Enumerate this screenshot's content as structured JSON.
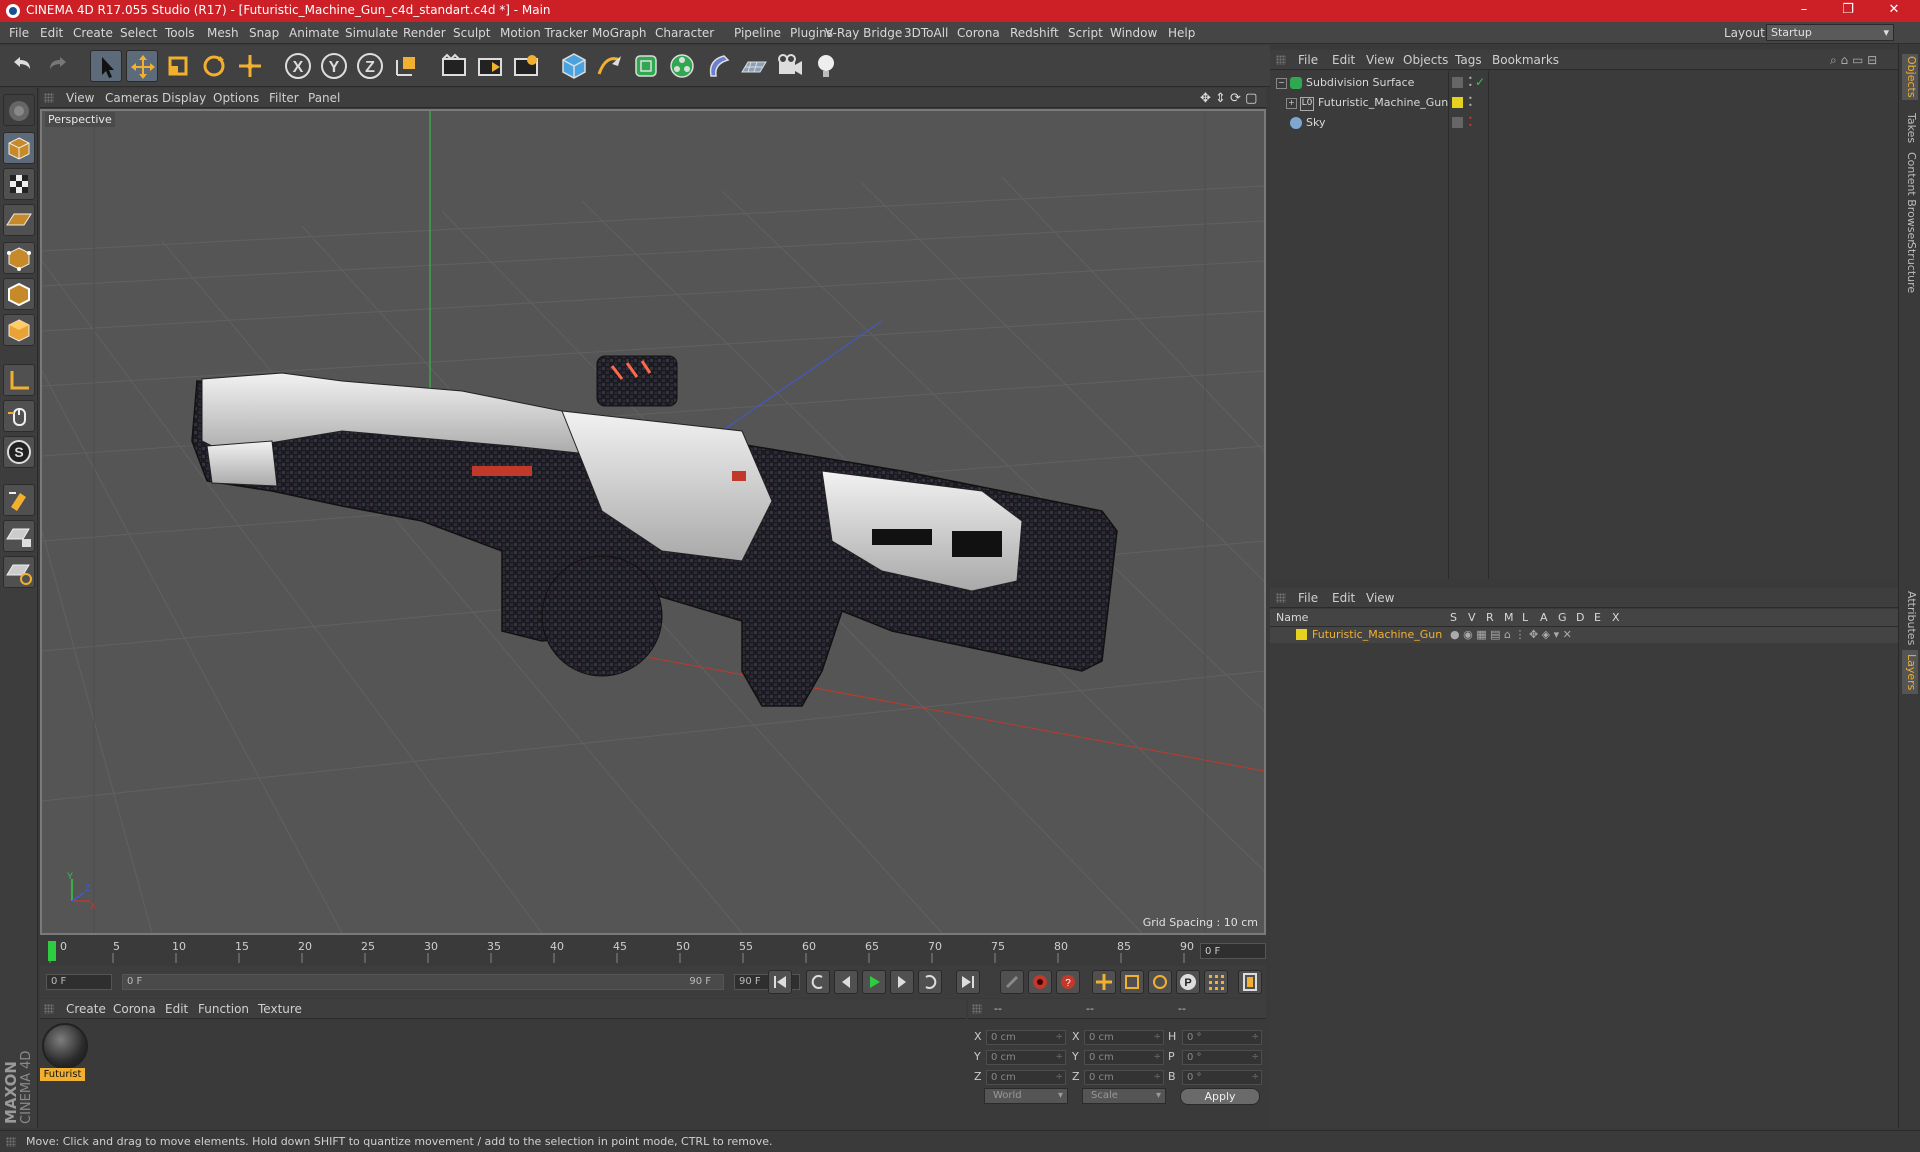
{
  "window": {
    "title": "CINEMA 4D R17.055 Studio (R17) - [Futuristic_Machine_Gun_c4d_standart.c4d *] - Main",
    "minimize": "–",
    "maximize": "❐",
    "close": "✕"
  },
  "menubar": {
    "items": [
      "File",
      "Edit",
      "Create",
      "Select",
      "Tools",
      "Mesh",
      "Snap",
      "Animate",
      "Simulate",
      "Render",
      "Sculpt",
      "Motion Tracker",
      "MoGraph",
      "Character",
      "Pipeline",
      "Plugins",
      "V-Ray Bridge",
      "3DToAll",
      "Corona",
      "Redshift",
      "Script",
      "Window",
      "Help"
    ],
    "layout_label": "Layout:",
    "layout_value": "Startup"
  },
  "viewport": {
    "menu": [
      "View",
      "Cameras",
      "Display",
      "Options",
      "Filter",
      "Panel"
    ],
    "camera_label": "Perspective",
    "grid_spacing": "Grid Spacing : 10 cm"
  },
  "timeline": {
    "ticks": [
      "0",
      "5",
      "10",
      "15",
      "20",
      "25",
      "30",
      "35",
      "40",
      "45",
      "50",
      "55",
      "60",
      "65",
      "70",
      "75",
      "80",
      "85",
      "90"
    ],
    "current_frame": "0 F",
    "start_field": "0 F",
    "range_start": "0 F",
    "range_end": "90 F",
    "end_field": "90 F"
  },
  "material_manager": {
    "menu": [
      "Create",
      "Corona",
      "Edit",
      "Function",
      "Texture"
    ],
    "material_name": "Futurist"
  },
  "coordinates": {
    "headers": [
      "--",
      "--",
      "--"
    ],
    "rows": [
      {
        "l1": "X",
        "v1": "0 cm",
        "l2": "X",
        "v2": "0 cm",
        "l3": "H",
        "v3": "0 °"
      },
      {
        "l1": "Y",
        "v1": "0 cm",
        "l2": "Y",
        "v2": "0 cm",
        "l3": "P",
        "v3": "0 °"
      },
      {
        "l1": "Z",
        "v1": "0 cm",
        "l2": "Z",
        "v2": "0 cm",
        "l3": "B",
        "v3": "0 °"
      }
    ],
    "mode_dropdown": "World",
    "scale_dropdown": "Scale",
    "apply_label": "Apply"
  },
  "object_manager": {
    "menu": [
      "File",
      "Edit",
      "View",
      "Objects",
      "Tags",
      "Bookmarks"
    ],
    "objects": [
      "Subdivision Surface",
      "Futuristic_Machine_Gun",
      "Sky"
    ]
  },
  "layer_manager": {
    "menu": [
      "File",
      "Edit",
      "View"
    ],
    "columns": [
      "Name",
      "S",
      "V",
      "R",
      "M",
      "L",
      "A",
      "G",
      "D",
      "E",
      "X"
    ],
    "layer_name": "Futuristic_Machine_Gun"
  },
  "right_tabs": [
    "Objects",
    "Takes",
    "Content Browser",
    "Structure",
    "Attributes",
    "Layers"
  ],
  "status": {
    "text": "Move: Click and drag to move elements. Hold down SHIFT to quantize movement / add to the selection in point mode, CTRL to remove."
  },
  "branding": {
    "maxon": "MAXON",
    "product": "CINEMA 4D"
  },
  "colors": {
    "title_bar": "#cc1f26",
    "accent_orange": "#f1b030",
    "layer_yellow": "#e6d21e",
    "axis_x": "#c0392b",
    "axis_y": "#2ecc40",
    "axis_z": "#3b5bdb"
  }
}
